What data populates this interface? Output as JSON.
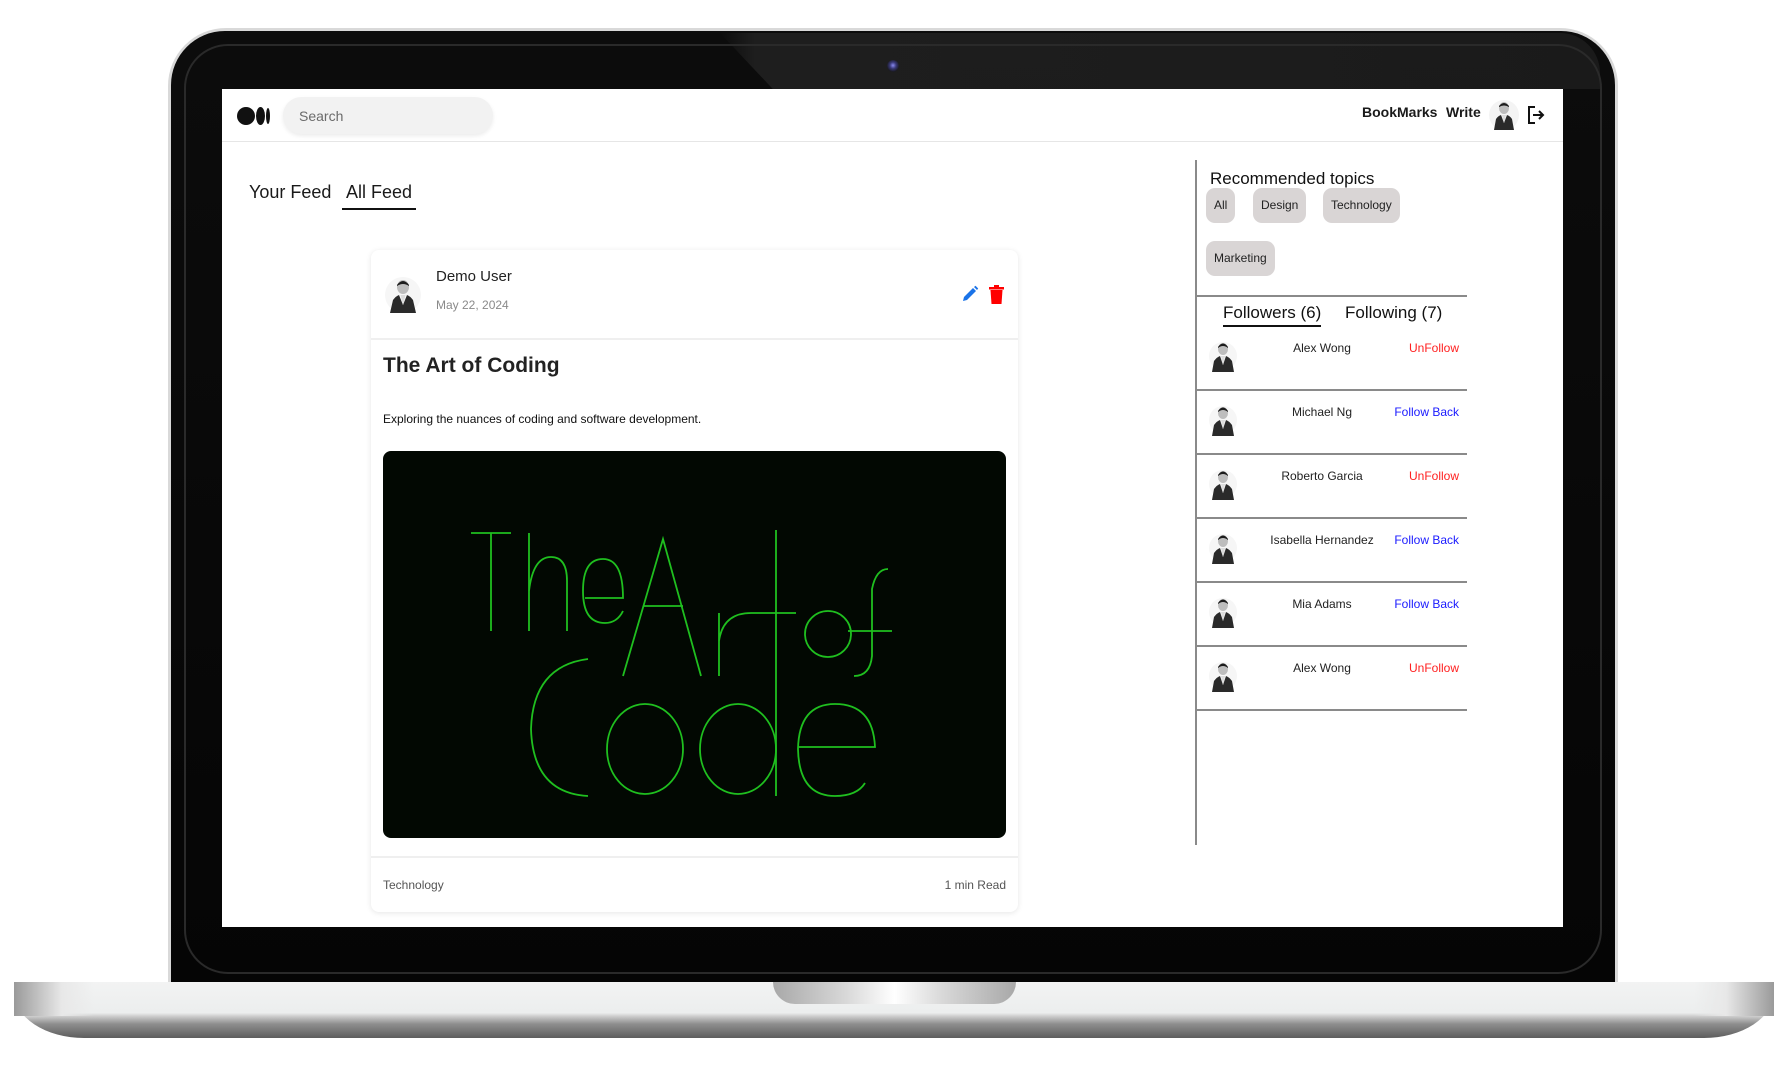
{
  "header": {
    "search_placeholder": "Search",
    "nav": {
      "bookmarks_label": "BookMarks",
      "write_label": "Write"
    },
    "icons": {
      "logo": "medium-logo-icon",
      "avatar": "user-avatar-icon",
      "logout": "logout-icon"
    }
  },
  "feed_tabs": [
    {
      "label": "Your Feed",
      "active": false
    },
    {
      "label": "All Feed",
      "active": true
    }
  ],
  "post": {
    "author": "Demo User",
    "date": "May 22, 2024",
    "title": "The Art of Coding",
    "description": "Exploring the nuances of coding and software development.",
    "image_text": [
      "The Art of",
      "Code"
    ],
    "tag": "Technology",
    "read_time": "1 min Read",
    "icons": {
      "edit": "pencil-icon",
      "delete": "trash-icon"
    },
    "colors": {
      "edit": "#1a73e8",
      "delete": "#ff0000",
      "image_bg": "#020802",
      "image_stroke": "#1fbf1f"
    }
  },
  "sidebar": {
    "recommended_title": "Recommended topics",
    "topics": [
      "All",
      "Design",
      "Technology",
      "Marketing"
    ],
    "tabs": {
      "followers_label": "Followers (6)",
      "following_label": "Following (7)"
    },
    "followers": [
      {
        "name": "Alex Wong",
        "action": "UnFollow",
        "type": "unfollow"
      },
      {
        "name": "Michael Ng",
        "action": "Follow Back",
        "type": "follow"
      },
      {
        "name": "Roberto Garcia",
        "action": "UnFollow",
        "type": "unfollow"
      },
      {
        "name": "Isabella Hernandez",
        "action": "Follow Back",
        "type": "follow"
      },
      {
        "name": "Mia Adams",
        "action": "Follow Back",
        "type": "follow"
      },
      {
        "name": "Alex Wong",
        "action": "UnFollow",
        "type": "unfollow"
      }
    ],
    "colors": {
      "unfollow": "#ff2020",
      "follow": "#1a1aff"
    }
  }
}
